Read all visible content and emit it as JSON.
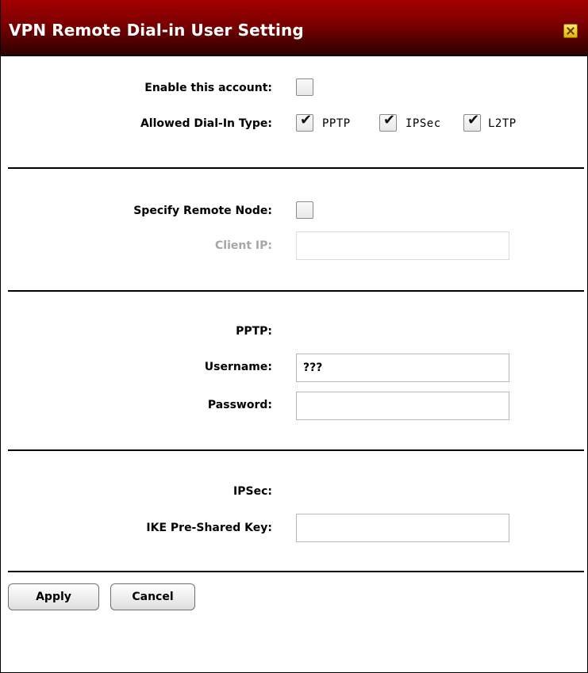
{
  "window": {
    "title": "VPN Remote Dial-in User Setting"
  },
  "account": {
    "enable_label": "Enable this account:",
    "enable_checked": false,
    "dialin_label": "Allowed Dial-In Type:",
    "types": [
      {
        "label": "PPTP",
        "checked": true
      },
      {
        "label": "IPSec",
        "checked": true
      },
      {
        "label": "L2TP",
        "checked": true
      }
    ]
  },
  "remote": {
    "specify_label": "Specify Remote Node:",
    "specify_checked": false,
    "client_ip_label": "Client IP:",
    "client_ip_value": ""
  },
  "pptp": {
    "section_label": "PPTP:",
    "username_label": "Username:",
    "username_value": "???",
    "password_label": "Password:",
    "password_value": ""
  },
  "ipsec": {
    "section_label": "IPSec:",
    "psk_label": "IKE Pre-Shared Key:",
    "psk_value": ""
  },
  "buttons": {
    "apply": "Apply",
    "cancel": "Cancel"
  },
  "check_glyph": "✔",
  "colors": {
    "title_bar": "#8b0000",
    "title_text": "#ffffff",
    "close_button": "#f5c400"
  }
}
